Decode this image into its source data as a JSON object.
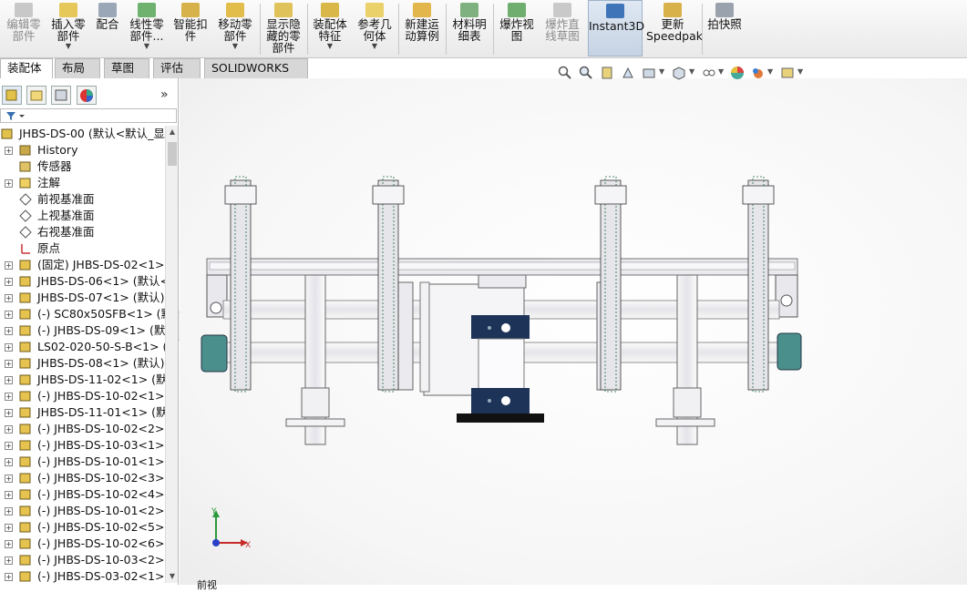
{
  "ribbon": {
    "buttons": [
      {
        "label": "编辑零\n部件",
        "icon": "edit-part-icon",
        "disabled": true
      },
      {
        "label": "插入零\n部件",
        "icon": "insert-component-icon",
        "dropdown": true
      },
      {
        "label": "配合",
        "icon": "mate-icon"
      },
      {
        "label": "线性零\n部件...",
        "icon": "linear-pattern-icon",
        "dropdown": true
      },
      {
        "label": "智能扣\n件",
        "icon": "smart-fasteners-icon"
      },
      {
        "label": "移动零\n部件",
        "icon": "move-component-icon",
        "dropdown": true
      },
      {
        "label": "显示隐\n藏的零\n部件",
        "icon": "show-hidden-icon"
      },
      {
        "label": "装配体\n特征",
        "icon": "assembly-feature-icon",
        "dropdown": true
      },
      {
        "label": "参考几\n何体",
        "icon": "reference-geometry-icon",
        "dropdown": true
      },
      {
        "label": "新建运\n动算例",
        "icon": "new-motion-study-icon"
      },
      {
        "label": "材料明\n细表",
        "icon": "bom-icon"
      },
      {
        "label": "爆炸视\n图",
        "icon": "exploded-view-icon"
      },
      {
        "label": "爆炸直\n线草图",
        "icon": "explode-line-sketch-icon",
        "disabled": true
      },
      {
        "label": "Instant3D",
        "icon": "instant3d-icon",
        "active": true
      },
      {
        "label": "更新\nSpeedpak",
        "icon": "update-speedpak-icon"
      },
      {
        "label": "拍快照",
        "icon": "snapshot-icon"
      }
    ]
  },
  "tabs": [
    "装配体",
    "布局",
    "草图",
    "评估",
    "SOLIDWORKS 插件"
  ],
  "active_tab": "装配体",
  "panel": {
    "expand_glyph": "»",
    "tree": [
      {
        "label": "JHBS-DS-00  (默认<默认_显示",
        "icon": "assembly-icon",
        "expander": "none",
        "root": true
      },
      {
        "label": "History",
        "icon": "history-icon",
        "expander": "+"
      },
      {
        "label": "传感器",
        "icon": "sensor-icon",
        "expander": "none"
      },
      {
        "label": "注解",
        "icon": "annotation-icon",
        "expander": "+"
      },
      {
        "label": "前视基准面",
        "icon": "plane-icon",
        "expander": "none"
      },
      {
        "label": "上视基准面",
        "icon": "plane-icon",
        "expander": "none"
      },
      {
        "label": "右视基准面",
        "icon": "plane-icon",
        "expander": "none"
      },
      {
        "label": "原点",
        "icon": "origin-icon",
        "expander": "none"
      },
      {
        "label": "(固定) JHBS-DS-02<1> (",
        "icon": "subassembly-icon",
        "expander": "+"
      },
      {
        "label": "JHBS-DS-06<1> (默认<<",
        "icon": "subassembly-icon",
        "expander": "+"
      },
      {
        "label": "JHBS-DS-07<1> (默认)",
        "icon": "subassembly-icon",
        "expander": "+"
      },
      {
        "label": "(-) SC80x50SFB<1> (默认",
        "icon": "subassembly-icon",
        "expander": "+"
      },
      {
        "label": "(-) JHBS-DS-09<1> (默认",
        "icon": "subassembly-icon",
        "expander": "+"
      },
      {
        "label": "LS02-020-50-S-B<1> (默",
        "icon": "subassembly-icon",
        "expander": "+"
      },
      {
        "label": "JHBS-DS-08<1> (默认)",
        "icon": "subassembly-icon",
        "expander": "+"
      },
      {
        "label": "JHBS-DS-11-02<1> (默认",
        "icon": "subassembly-icon",
        "expander": "+"
      },
      {
        "label": "(-) JHBS-DS-10-02<1> (",
        "icon": "subassembly-icon",
        "expander": "+"
      },
      {
        "label": "JHBS-DS-11-01<1> (默认",
        "icon": "subassembly-icon",
        "expander": "+"
      },
      {
        "label": "(-) JHBS-DS-10-02<2> (",
        "icon": "subassembly-icon",
        "expander": "+"
      },
      {
        "label": "(-) JHBS-DS-10-03<1> (",
        "icon": "subassembly-icon",
        "expander": "+"
      },
      {
        "label": "(-) JHBS-DS-10-01<1> (",
        "icon": "subassembly-icon",
        "expander": "+"
      },
      {
        "label": "(-) JHBS-DS-10-02<3> (",
        "icon": "subassembly-icon",
        "expander": "+"
      },
      {
        "label": "(-) JHBS-DS-10-02<4> (",
        "icon": "subassembly-icon",
        "expander": "+"
      },
      {
        "label": "(-) JHBS-DS-10-01<2> (",
        "icon": "subassembly-icon",
        "expander": "+"
      },
      {
        "label": "(-) JHBS-DS-10-02<5> (",
        "icon": "subassembly-icon",
        "expander": "+"
      },
      {
        "label": "(-) JHBS-DS-10-02<6> (",
        "icon": "subassembly-icon",
        "expander": "+"
      },
      {
        "label": "(-) JHBS-DS-10-03<2> (",
        "icon": "subassembly-icon",
        "expander": "+"
      },
      {
        "label": "(-) JHBS-DS-03-02<1> (",
        "icon": "subassembly-icon",
        "expander": "+"
      }
    ]
  },
  "viewport": {
    "triad": {
      "x": "X",
      "y": "Y"
    },
    "bottom_text": "前视"
  },
  "colors": {
    "accent": "#1f66c2",
    "blue_block": "#1d3458",
    "frame": "#d9d9dd",
    "shaft": "#f2f2f4"
  }
}
